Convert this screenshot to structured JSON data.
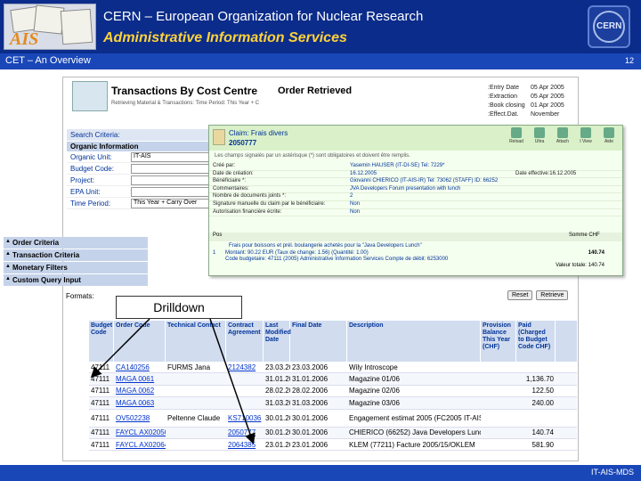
{
  "header": {
    "title": "CERN – European Organization for Nuclear Research",
    "subtitle": "Administrative Information Services",
    "logo_text": "AIS",
    "cern_logo": "CERN"
  },
  "subbar": {
    "label": "CET – An Overview",
    "page": "12"
  },
  "footer": {
    "label": "IT-AIS-MDS"
  },
  "app": {
    "title": "Transactions By Cost Centre",
    "subtitle": "Retrieving Material & Transactions: Time Period: This Year + C"
  },
  "criteria": {
    "head": "Search Criteria:",
    "section": "Organic Information",
    "rows": [
      {
        "label": "Organic Unit:",
        "value": "IT-AIS"
      },
      {
        "label": "Budget Code:",
        "value": ""
      },
      {
        "label": "Project:",
        "value": ""
      },
      {
        "label": "EPA Unit:",
        "value": ""
      },
      {
        "label": "Time Period:",
        "value": "This Year + Carry Over"
      }
    ]
  },
  "filters": [
    "Order Criteria",
    "Transaction Criteria",
    "Monetary Filters",
    "Custom Query Input"
  ],
  "order": {
    "title": "Order Retrieved",
    "dates": [
      {
        "k": ":Entry Date",
        "v": "05 Apr 2005"
      },
      {
        "k": ":Extraction",
        "v": "05 Apr 2005"
      },
      {
        "k": ":Book closing",
        "v": "01 Apr 2005"
      },
      {
        "k": ":Effect.Dat.",
        "v": "November"
      }
    ]
  },
  "claim": {
    "title": "Claim: Frais divers",
    "number": "2050777",
    "tools": [
      "Reload",
      "Ultra",
      "Attach",
      "I View",
      "Aide"
    ],
    "note": "Les champs signalés par un astérisque (*) sont obligatoires et doivent être remplis.",
    "rows": [
      {
        "k": "Créé par:",
        "v": "Yasemin HAUSER (IT-DI-SE) Tel: 7229*",
        "v2": ""
      },
      {
        "k": "Date de création:",
        "v": "16.12.2005",
        "v2": "Date effective:16.12.2005"
      },
      {
        "k": "Bénéficiaire *:",
        "v": "Giovanni CHIERICO (IT-AIS-IR) Tel: 73062 (STAFF) ID: 66252",
        "v2": ""
      },
      {
        "k": "Commentaires:",
        "v": "JVA Developers Forum presentation with lunch",
        "v2": ""
      },
      {
        "k": "Nombre de documents joints *:",
        "v": "2",
        "v2": ""
      },
      {
        "k": "Signature manuelle du claim par le bénéficiaire:",
        "v": "Non",
        "v2": ""
      },
      {
        "k": "Autorisation financière écrite:",
        "v": "Non",
        "v2": ""
      }
    ],
    "pos_head": [
      "Pos",
      "Somme CHF"
    ],
    "pos_lines": [
      "Frais pour boissons et prél. boulangerie achetés pour la \"Java Developers Lunch\"",
      "Montant: 90.22 EUR (Taux de change: 1.56) (Quantité: 1.00)",
      "Code budgetaire: 47111 (2005) Administrative Information Services  Compte de débit: 6253000"
    ],
    "pos_num": "1",
    "amount": "140.74",
    "valeur": "Valeur totale: 140.74"
  },
  "formats": {
    "label": "Formats:"
  },
  "format_buttons": [
    "Reset",
    "Retrieve"
  ],
  "drilldown": "Drilldown",
  "table": {
    "headers": [
      "Budget Code",
      "Order Code",
      "Technical Contact",
      "Contract Agreement",
      "Last Modified Date",
      "Final Date",
      "Description",
      "Provision Balance This Year (CHF)",
      "Paid (Charged to Budget Code CHF)"
    ],
    "rows": [
      {
        "c0": "47111",
        "c1": "CA140256",
        "c2": "FURMS Jana",
        "c3": "2124382",
        "c4": "23.03.2006",
        "c5": "23.03.2006",
        "c7": "Wily Introscope",
        "c8": "",
        "c9": ""
      },
      {
        "c0": "47111",
        "c1": "MAGA 0061",
        "c2": "",
        "c3": "",
        "c4": "31.01.2006",
        "c5": "31.01.2006",
        "c7": "Magazine 01/06",
        "c8": "",
        "c9": "1,136.70"
      },
      {
        "c0": "47111",
        "c1": "MAGA 0062",
        "c2": "",
        "c3": "",
        "c4": "28.02.2006",
        "c5": "28.02.2006",
        "c7": "Magazine 02/06",
        "c8": "",
        "c9": "122.50"
      },
      {
        "c0": "47111",
        "c1": "MAGA 0063",
        "c2": "",
        "c3": "",
        "c4": "31.03.2006",
        "c5": "31.03.2006",
        "c7": "Magazine 03/06",
        "c8": "",
        "c9": "240.00"
      },
      {
        "c0": "47111",
        "c1": "OV502238",
        "c2": "Peltenne Claude",
        "c3": "KS710036",
        "c4": "30.01.2006",
        "c5": "30.01.2006",
        "c7": "Engagement estimat 2005 (FC2005 IT-AIS)",
        "c8": "",
        "c9": ""
      },
      {
        "c0": "47111",
        "c1": "FAYCL AX02050777",
        "c2": "",
        "c3": "2050777",
        "c4": "30.01.2006",
        "c5": "30.01.2006",
        "c7": "CHIERICO (66252) Java Developers Lunch",
        "c8": "",
        "c9": "140.74"
      },
      {
        "c0": "47111",
        "c1": "FAYCL AX02064385",
        "c2": "",
        "c3": "2064385",
        "c4": "23.01.2006",
        "c5": "23.01.2006",
        "c7": "KLEM (77211) Facture 2005/15/OKLEM",
        "c8": "",
        "c9": "581.90"
      }
    ]
  }
}
